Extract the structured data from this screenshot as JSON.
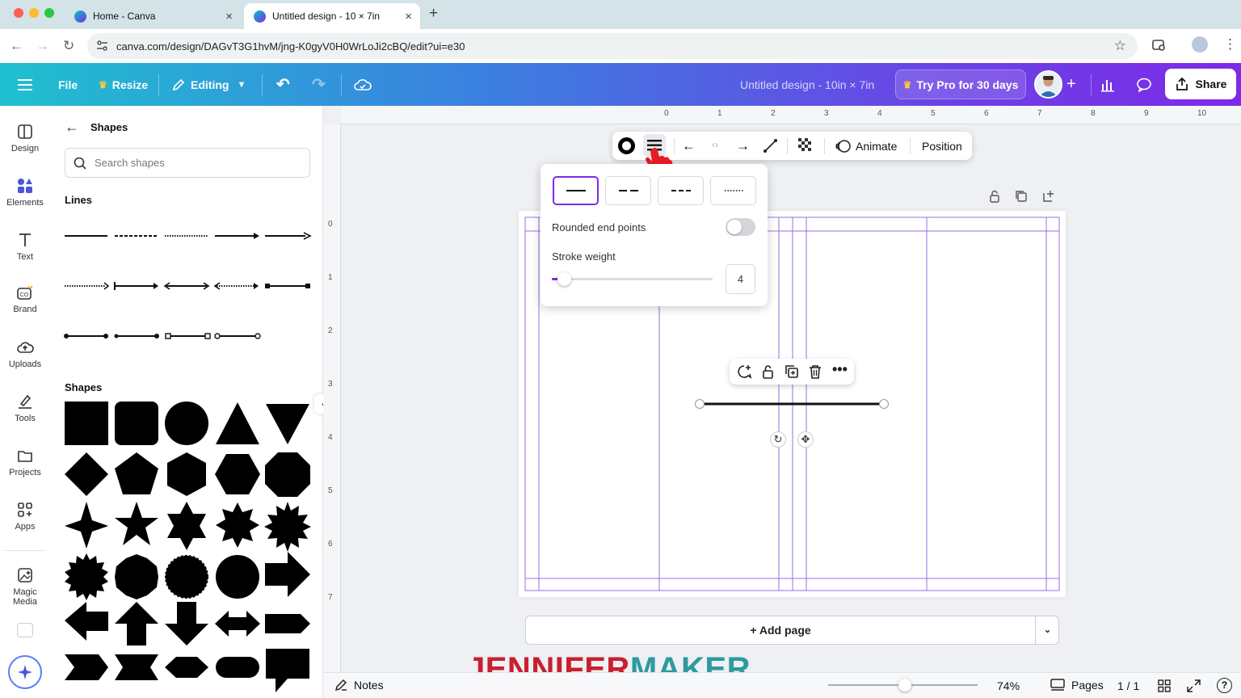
{
  "browser": {
    "tabs": [
      {
        "title": "Home - Canva"
      },
      {
        "title": "Untitled design - 10 × 7in"
      }
    ],
    "new_tab": "+",
    "url": "canva.com/design/DAGvT3G1hvM/jng-K0gyV0H0WrLoJi2cBQ/edit?ui=e30"
  },
  "toolbar": {
    "file": "File",
    "resize": "Resize",
    "editing": "Editing",
    "doc_title": "Untitled design - 10in × 7in",
    "try_pro": "Try Pro for 30 days",
    "share": "Share"
  },
  "rail": [
    {
      "label": "Design"
    },
    {
      "label": "Elements"
    },
    {
      "label": "Text"
    },
    {
      "label": "Brand"
    },
    {
      "label": "Uploads"
    },
    {
      "label": "Tools"
    },
    {
      "label": "Projects"
    },
    {
      "label": "Apps"
    },
    {
      "label": "Magic Media"
    }
  ],
  "panel": {
    "title": "Shapes",
    "search_placeholder": "Search shapes",
    "lines_heading": "Lines",
    "shapes_heading": "Shapes"
  },
  "context_toolbar": {
    "animate": "Animate",
    "position": "Position"
  },
  "line_popover": {
    "rounded_label": "Rounded end points",
    "rounded_on": false,
    "stroke_label": "Stroke weight",
    "stroke_value": "4"
  },
  "ruler": {
    "top": [
      "0",
      "1",
      "2",
      "3",
      "4",
      "5",
      "6",
      "7",
      "8",
      "9",
      "10"
    ],
    "left": [
      "0",
      "1",
      "2",
      "3",
      "4",
      "5",
      "6",
      "7"
    ]
  },
  "add_page": "+ Add page",
  "bottom": {
    "notes": "Notes",
    "zoom": "74%",
    "pages": "Pages",
    "page_count": "1 / 1"
  },
  "watermark": {
    "part1": "JENNIFER",
    "part2": "MAKER"
  },
  "colors": {
    "accent": "#7d2ae8",
    "watermark_red": "#c8202f",
    "watermark_teal": "#2e9a9e"
  }
}
